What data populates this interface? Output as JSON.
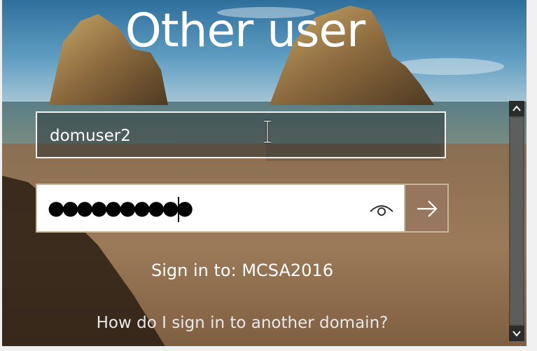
{
  "title": "Other user",
  "username": {
    "value": "domuser2"
  },
  "password": {
    "masked_value": "●●●●●●●●●●",
    "reveal_icon": "eye-icon"
  },
  "submit": {
    "icon": "arrow-right-icon"
  },
  "signin_to": "Sign in to: MCSA2016",
  "other_domain_link": "How do I sign in to another domain?",
  "scrollbar": {
    "up_icon": "chevron-up-icon",
    "down_icon": "chevron-down-icon"
  },
  "colors": {
    "field_border": "#f2f2f2",
    "submit_background": "#96785f",
    "text": "#ffffff"
  }
}
